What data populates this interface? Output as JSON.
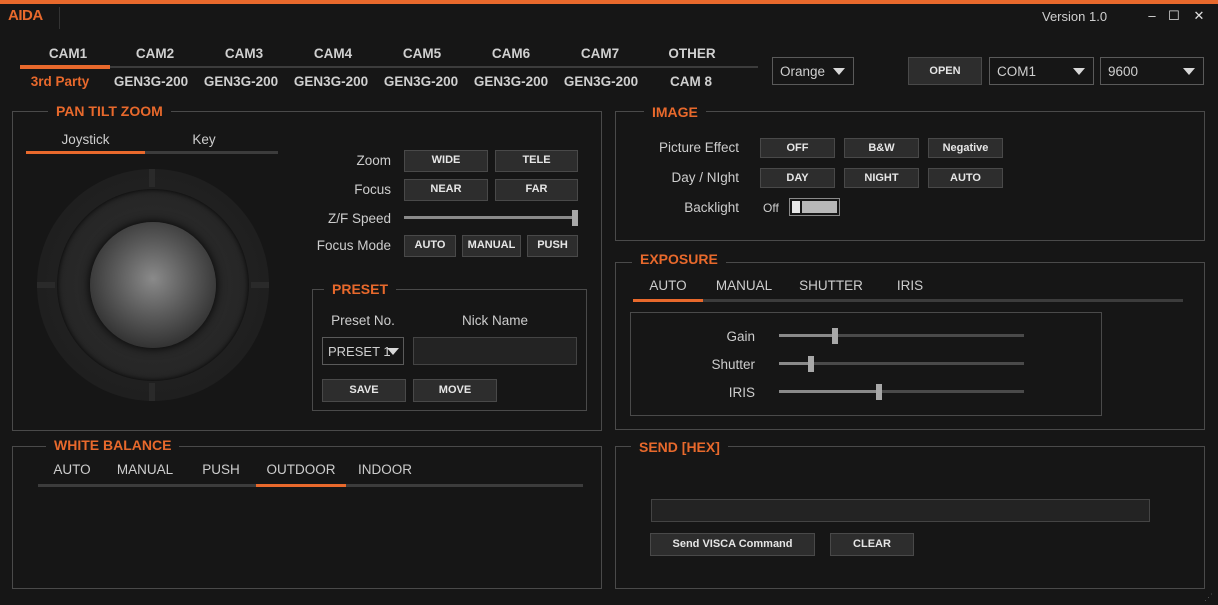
{
  "app": {
    "logo": "AIDA",
    "version": "Version 1.0",
    "minimize_icon": "–",
    "maximize_icon": "☐",
    "close_icon": "✕"
  },
  "cams": {
    "tabs": [
      "CAM1",
      "CAM2",
      "CAM3",
      "CAM4",
      "CAM5",
      "CAM6",
      "CAM7",
      "OTHER"
    ],
    "models": [
      "3rd Party",
      "GEN3G-200",
      "GEN3G-200",
      "GEN3G-200",
      "GEN3G-200",
      "GEN3G-200",
      "GEN3G-200",
      "CAM 8"
    ],
    "selected_index": 0
  },
  "theme": {
    "selected": "Orange",
    "accent": "#e8692c"
  },
  "connection": {
    "open_label": "OPEN",
    "port": "COM1",
    "baud": "9600"
  },
  "ptz": {
    "title": "PAN TILT ZOOM",
    "tabs": [
      "Joystick",
      "Key"
    ],
    "zoom_label": "Zoom",
    "wide": "WIDE",
    "tele": "TELE",
    "focus_label": "Focus",
    "near": "NEAR",
    "far": "FAR",
    "zf_speed_label": "Z/F Speed",
    "zf_speed_value": 1.0,
    "focus_mode_label": "Focus Mode",
    "fm_auto": "AUTO",
    "fm_manual": "MANUAL",
    "fm_push": "PUSH"
  },
  "preset": {
    "title": "PRESET",
    "no_label": "Preset No.",
    "nick_label": "Nick Name",
    "selected": "PRESET 1",
    "nick_value": "",
    "save": "SAVE",
    "move": "MOVE"
  },
  "image": {
    "title": "IMAGE",
    "picture_effect_label": "Picture Effect",
    "pe_off": "OFF",
    "pe_bw": "B&W",
    "pe_negative": "Negative",
    "day_night_label": "Day / NIght",
    "dn_day": "DAY",
    "dn_night": "NIGHT",
    "dn_auto": "AUTO",
    "backlight_label": "Backlight",
    "backlight_state": "Off"
  },
  "exposure": {
    "title": "EXPOSURE",
    "tabs": [
      "AUTO",
      "MANUAL",
      "SHUTTER",
      "IRIS"
    ],
    "gain_label": "Gain",
    "gain_value": 0.23,
    "shutter_label": "Shutter",
    "shutter_value": 0.13,
    "iris_label": "IRIS",
    "iris_value": 0.41
  },
  "white_balance": {
    "title": "WHITE BALANCE",
    "tabs": [
      "AUTO",
      "MANUAL",
      "PUSH",
      "OUTDOOR",
      "INDOOR"
    ],
    "selected_index": 3
  },
  "send": {
    "title": "SEND [HEX]",
    "command_value": "",
    "send_label": "Send VISCA Command",
    "clear_label": "CLEAR"
  }
}
